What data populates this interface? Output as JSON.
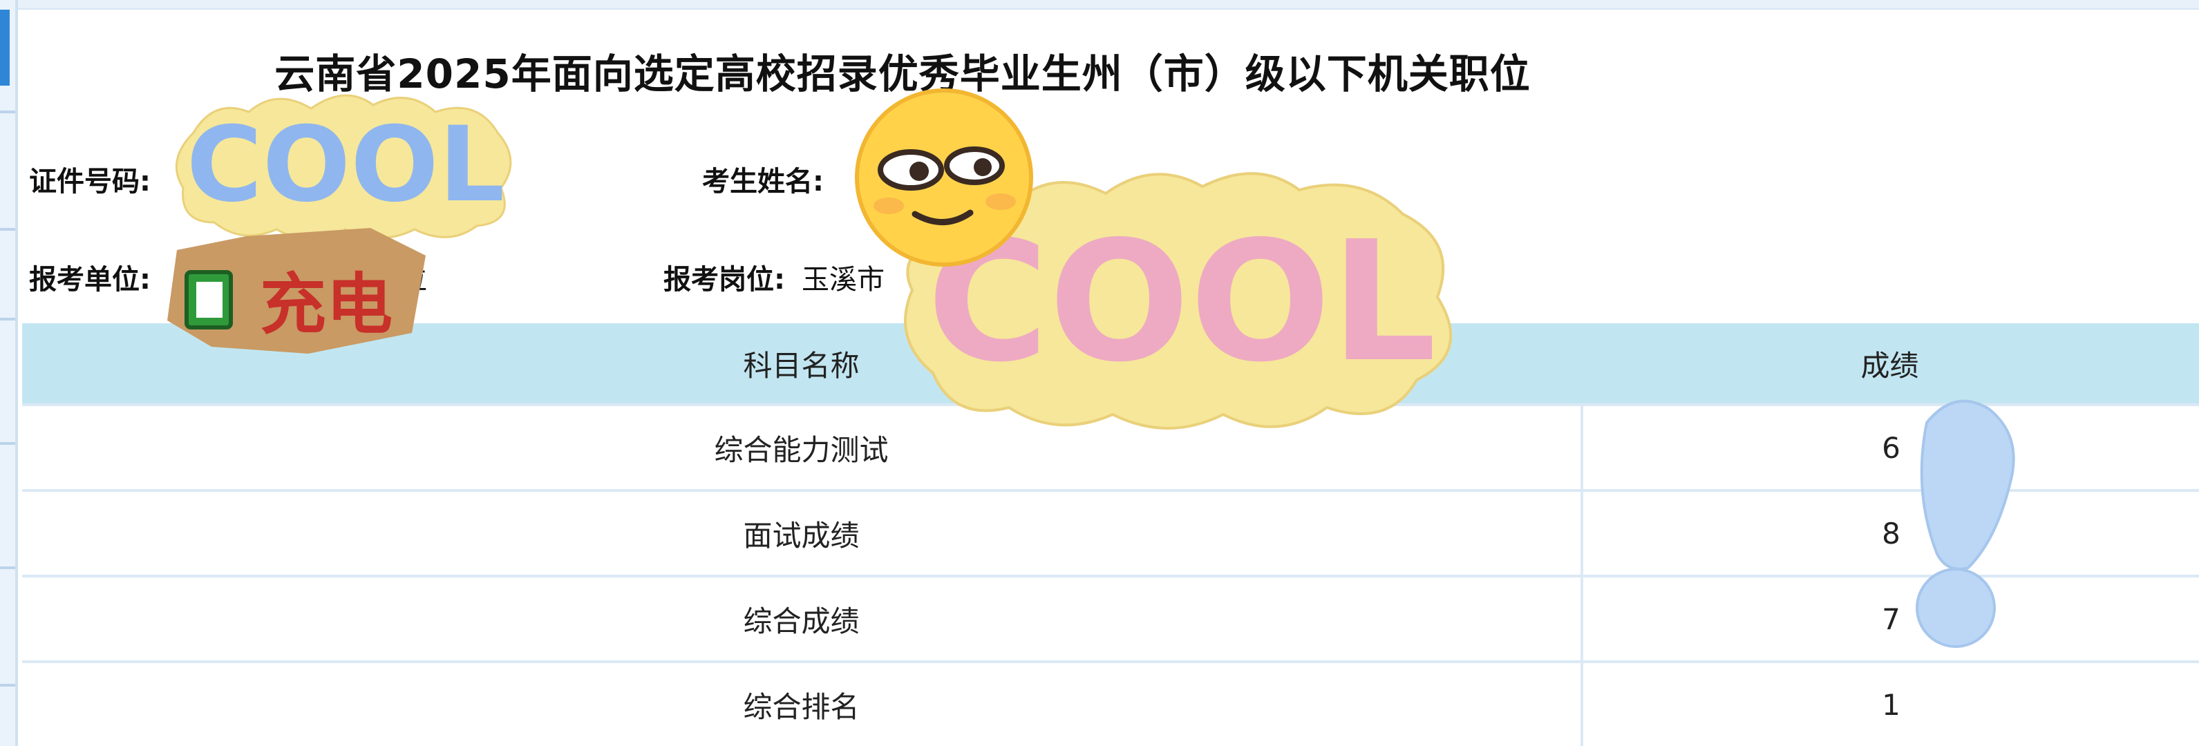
{
  "page": {
    "title": "云南省2025年面向选定高校招录优秀毕业生州（市）级以下机关职位"
  },
  "candidate": {
    "id_label": "证件号码:",
    "id_value": "",
    "name_label": "考生姓名:",
    "name_value": "",
    "unit_label": "报考单位:",
    "unit_value": "位",
    "post_label": "报考岗位:",
    "post_value": "玉溪市"
  },
  "table": {
    "headers": [
      "科目名称",
      "成绩"
    ],
    "rows": [
      {
        "subject": "综合能力测试",
        "score": "6"
      },
      {
        "subject": "面试成绩",
        "score": "8"
      },
      {
        "subject": "综合成绩",
        "score": "7"
      },
      {
        "subject": "综合排名",
        "score": "1"
      }
    ]
  },
  "stickers": {
    "cool_text": "COOL",
    "charge_text": "充电"
  },
  "colors": {
    "header_bg": "#c2e6f1",
    "sticker_yellow": "#f6e79a",
    "cool_blue": "#8fb6ef",
    "cool_pink": "#eeaac2",
    "cool_purple": "#b9a0ea",
    "cool_green": "#9fdcb5",
    "charge_red": "#c8302a",
    "charge_tan": "#c99a64",
    "emoji_yellow": "#ffd24a"
  }
}
